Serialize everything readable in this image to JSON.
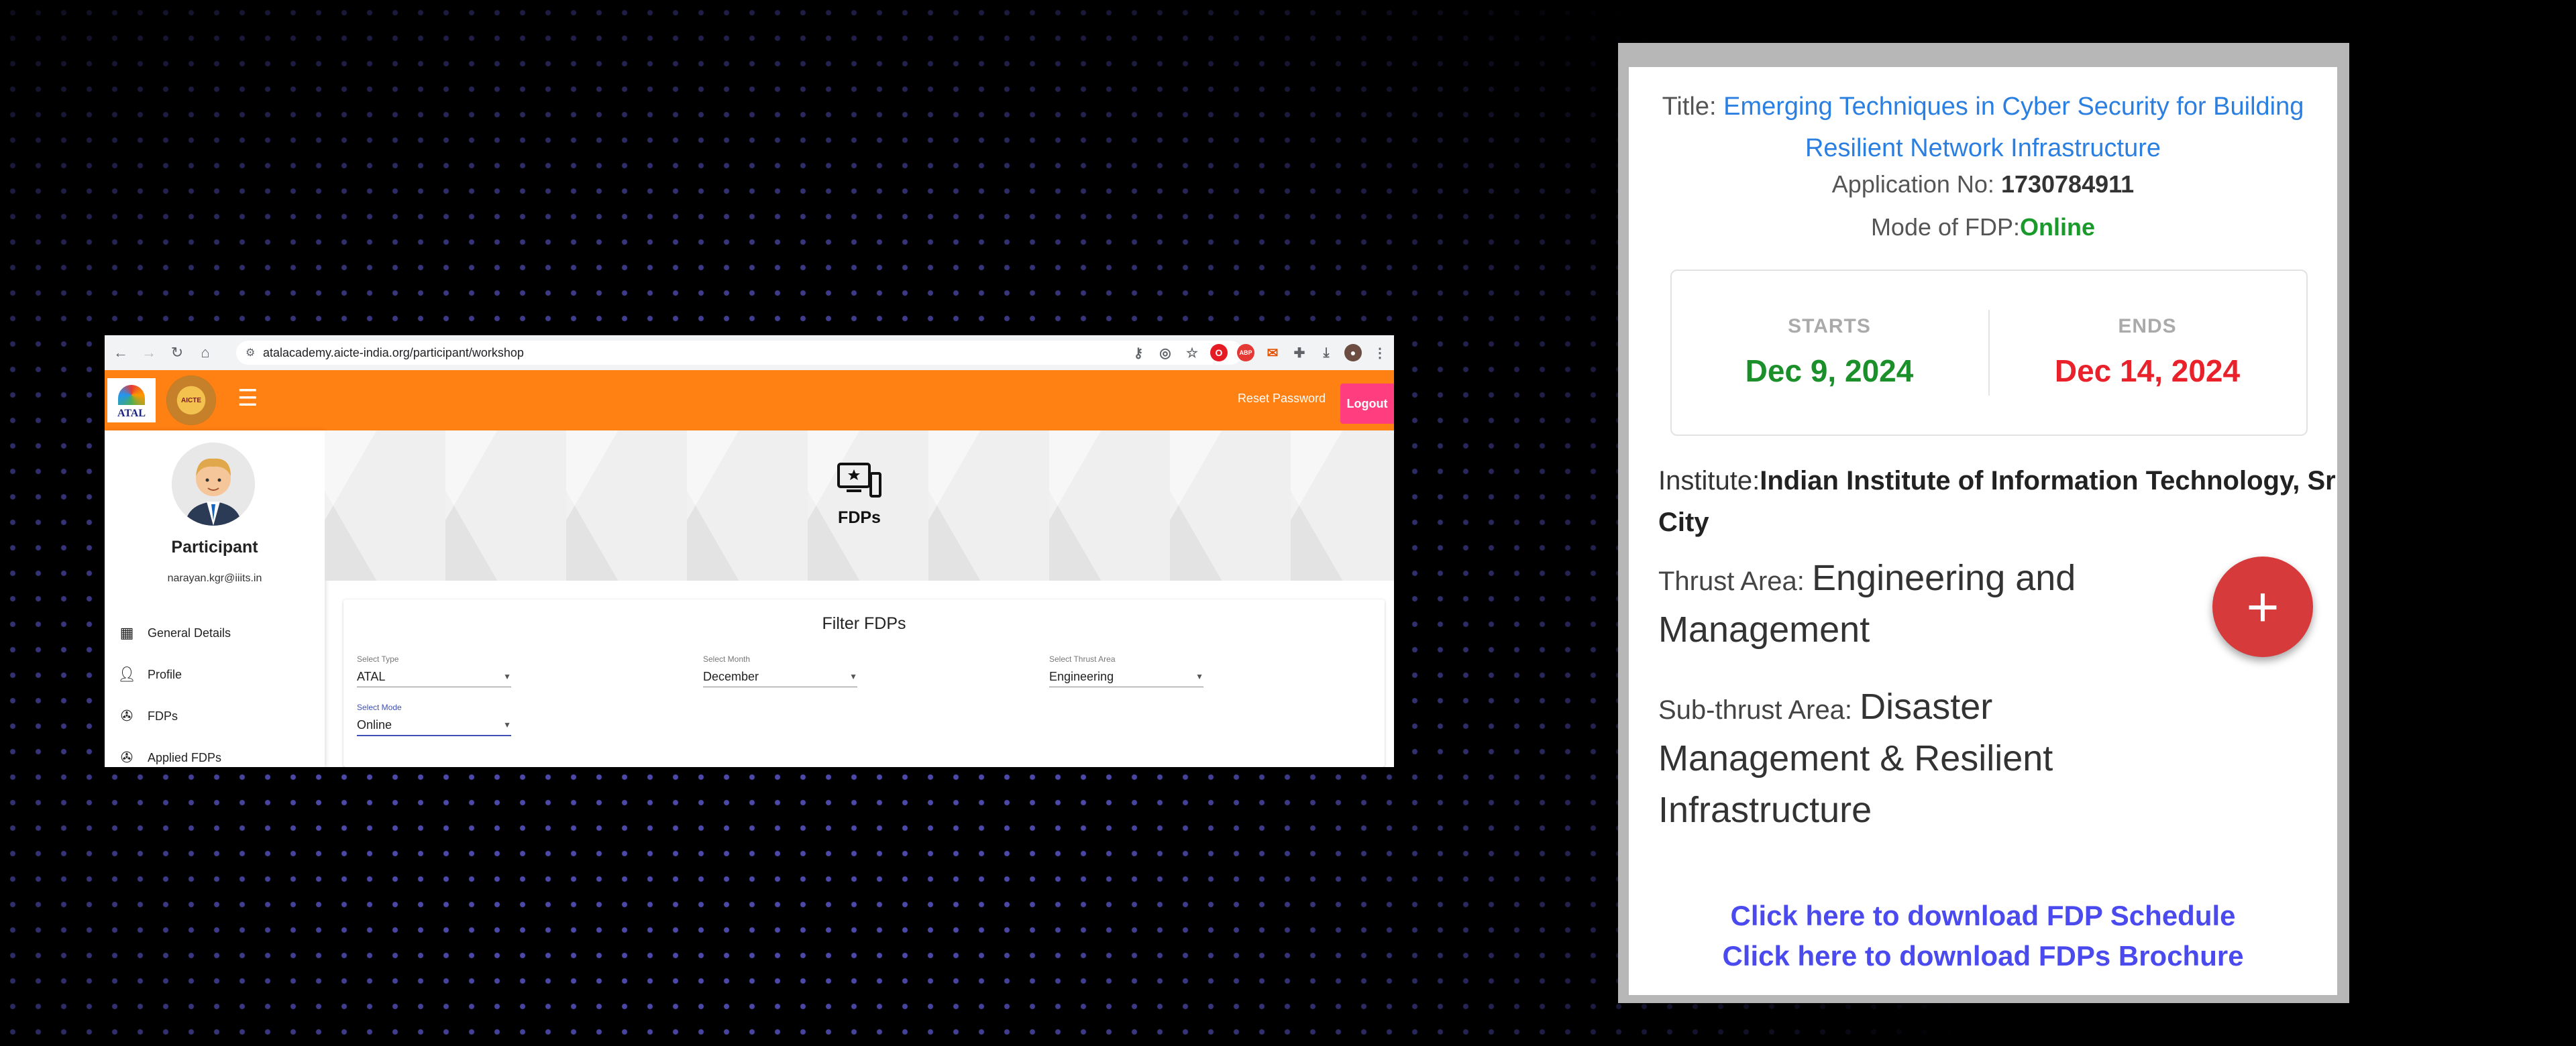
{
  "browser": {
    "url": "atalacademy.aicte-india.org/participant/workshop",
    "nav_icons": [
      "back-icon",
      "forward-icon",
      "reload-icon",
      "home-icon"
    ]
  },
  "header": {
    "atal_logo_text": "ATAL",
    "reset_password": "Reset Password",
    "logout": "Logout",
    "accent_color": "#ff8113",
    "logout_color": "#ff3d7f"
  },
  "sidebar": {
    "name": "Participant",
    "email": "narayan.kgr@iiits.in",
    "items": [
      {
        "label": "General Details",
        "icon": "dashboard-icon"
      },
      {
        "label": "Profile",
        "icon": "person-icon"
      },
      {
        "label": "FDPs",
        "icon": "fdp-icon"
      },
      {
        "label": "Applied FDPs",
        "icon": "fdp-icon"
      }
    ]
  },
  "banner": {
    "title": "FDPs",
    "icon": "monitor-star-icon"
  },
  "filter": {
    "title": "Filter FDPs",
    "type": {
      "label": "Select Type",
      "value": "ATAL"
    },
    "month": {
      "label": "Select Month",
      "value": "December"
    },
    "thrust": {
      "label": "Select Thrust Area",
      "value": "Engineering"
    },
    "mode": {
      "label": "Select Mode",
      "value": "Online"
    }
  },
  "card": {
    "title_label": "Title:",
    "title_value": "Emerging Techniques in Cyber Security for Building Resilient Network Infrastructure",
    "appno_label": "Application No:",
    "appno_value": "1730784911",
    "mode_label": "Mode of FDP:",
    "mode_value": "Online",
    "starts_label": "STARTS",
    "starts_value": "Dec 9, 2024",
    "ends_label": "ENDS",
    "ends_value": "Dec 14, 2024",
    "institute_label": "Institute:",
    "institute_value": "Indian Institute of Information Technology, Sri City",
    "thrust_label": "Thrust Area:",
    "thrust_value": "Engineering and Management",
    "subthrust_label": "Sub-thrust Area:",
    "subthrust_value": "Disaster Management & Resilient Infrastructure",
    "fab_label": "+",
    "download_schedule": "Click here to download FDP Schedule",
    "download_brochure": "Click here to download FDPs Brochure",
    "start_color": "#1a8f2a",
    "end_color": "#e8212a",
    "link_color": "#4a4aee"
  }
}
